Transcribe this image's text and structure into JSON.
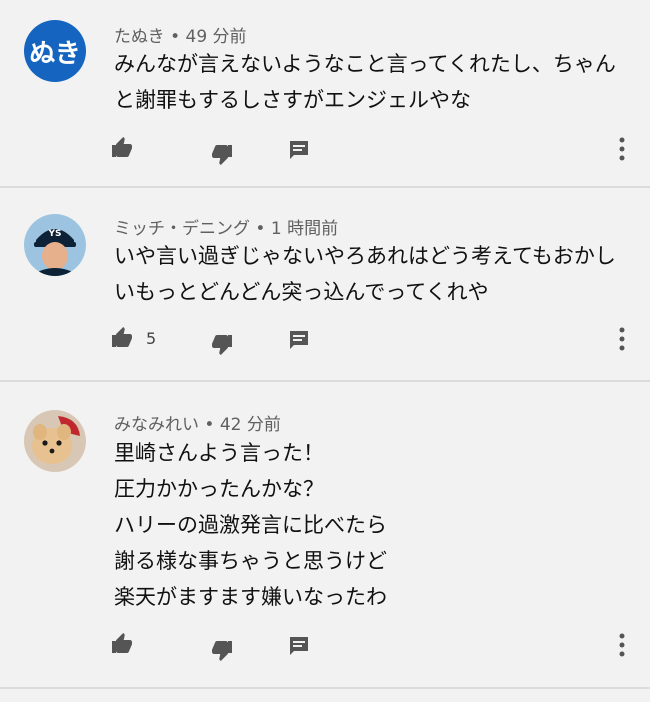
{
  "comments": [
    {
      "author": "たぬき",
      "time": "49 分前",
      "avatar_text": "ぬき",
      "avatar_color": "#1565c0",
      "text": "みんなが言えないようなこと言ってくれたし、ちゃんと謝罪もするしさすがエンジェルやな",
      "likes": ""
    },
    {
      "author": "ミッチ・デニング",
      "time": "1 時間前",
      "text": "いや言い過ぎじゃないやろあれはどう考えてもおかしいもっとどんどん突っ込んでってくれや",
      "likes": "5"
    },
    {
      "author": "みなみれい",
      "time": "42 分前",
      "text": "里崎さんよう言った！\n圧力かかったんかな？\nハリーの過激発言に比べたら\n謝る様な事ちゃうと思うけど\n楽天がますます嫌いなったわ",
      "likes": ""
    }
  ],
  "separator": " • ",
  "icons": [
    "thumb-up-icon",
    "thumb-down-icon",
    "reply-icon",
    "more-vert-icon"
  ]
}
